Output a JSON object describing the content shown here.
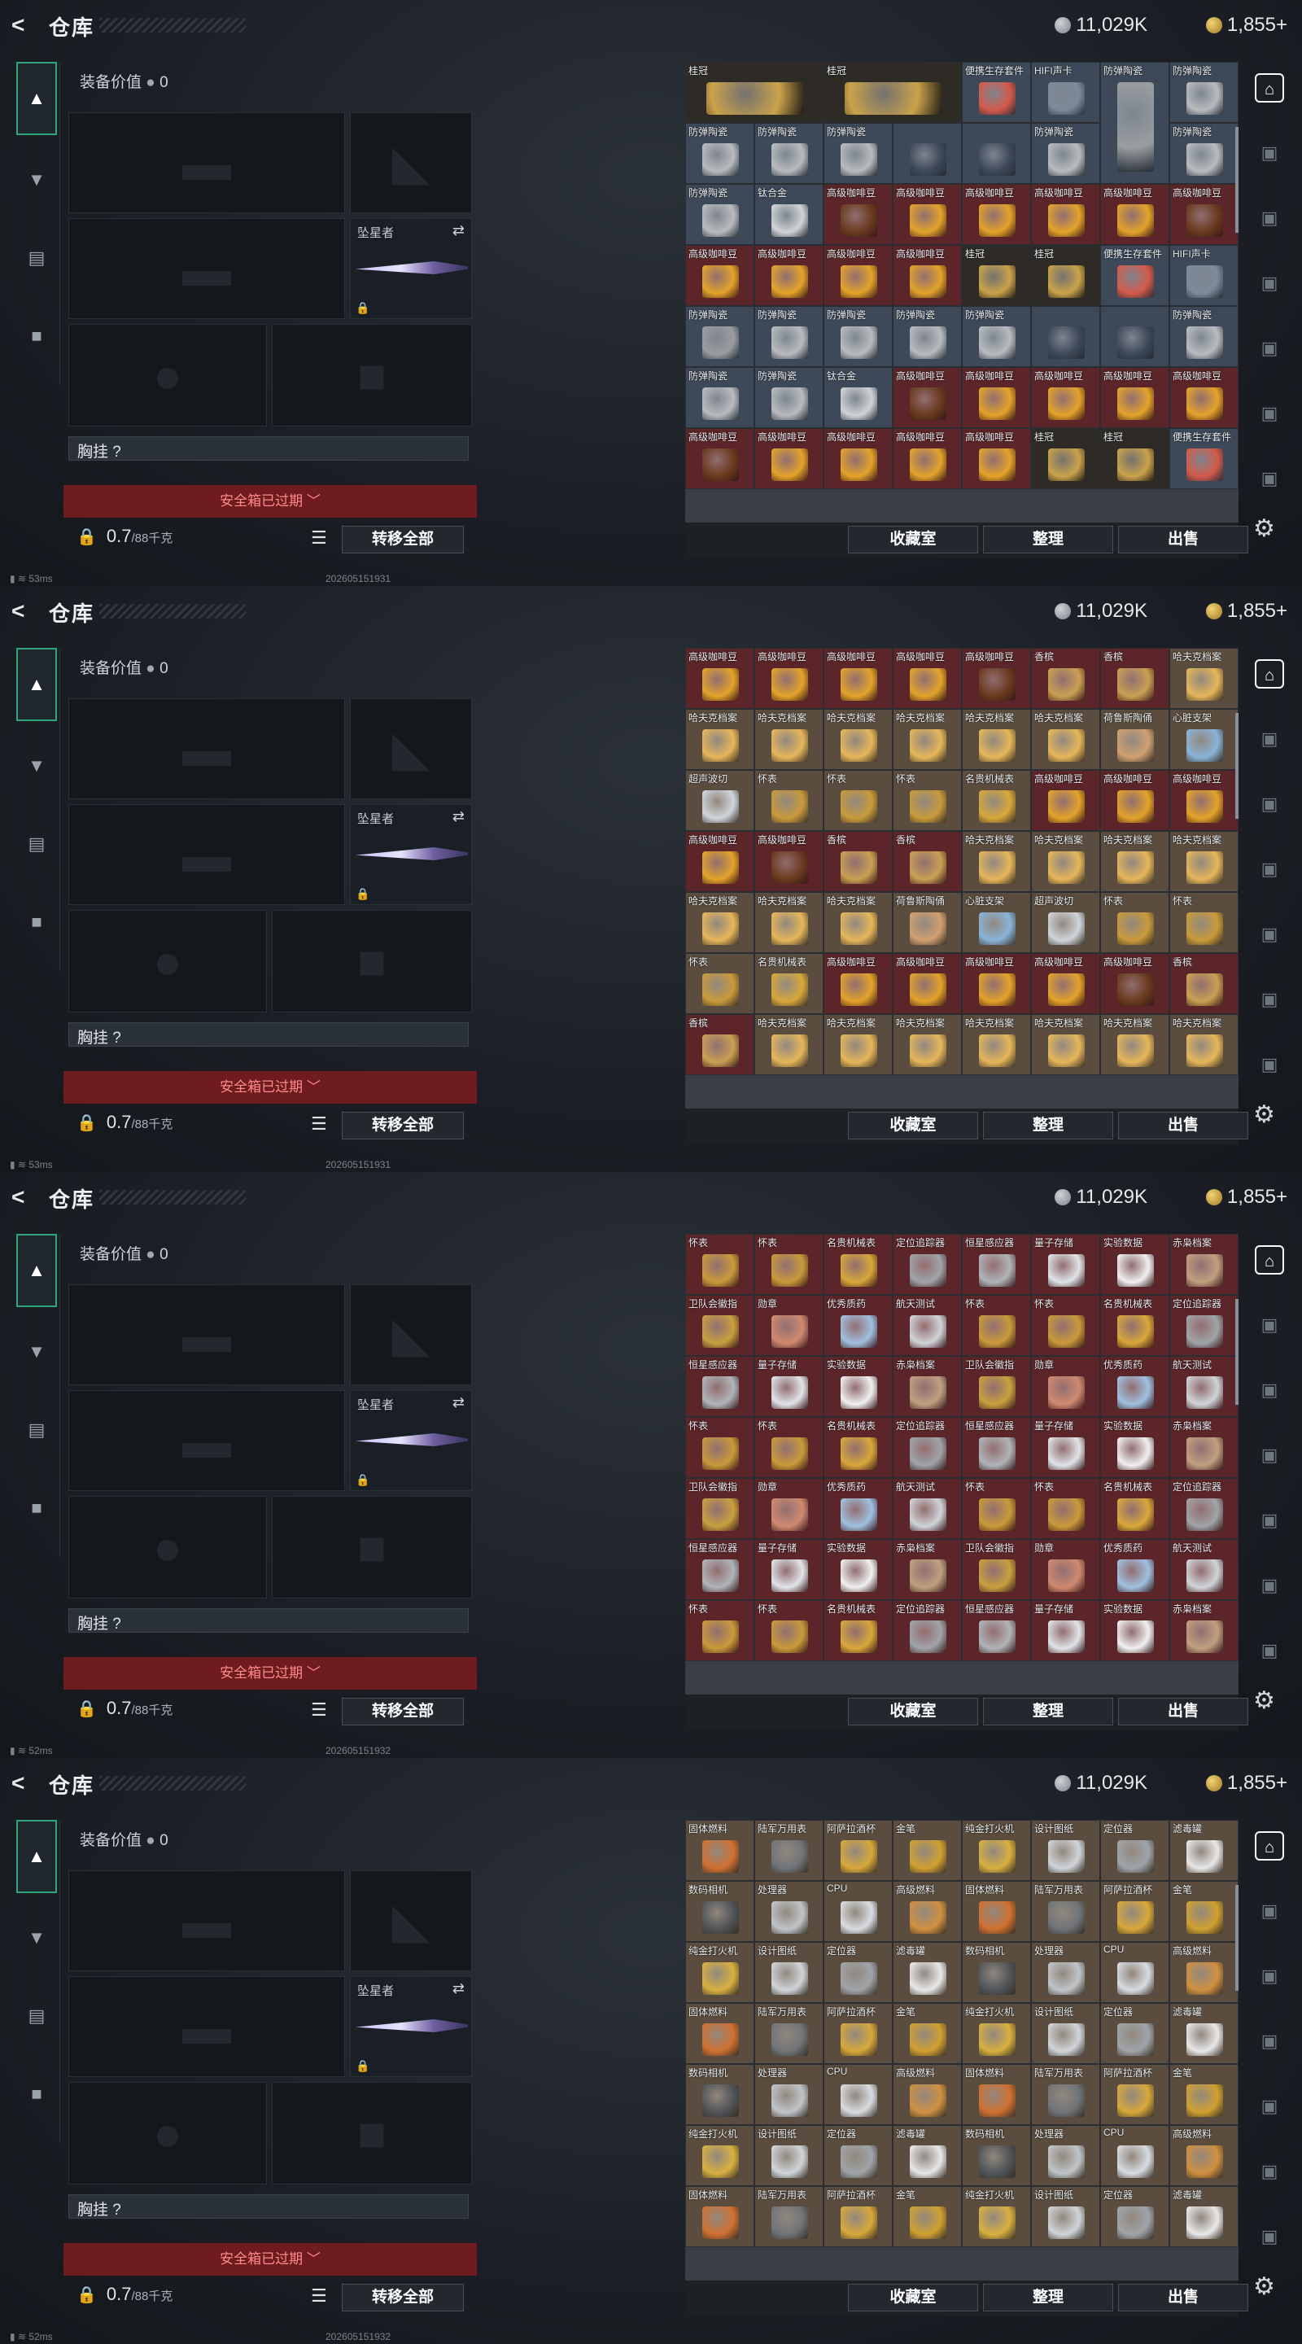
{
  "header": {
    "title": "仓库",
    "silver": "11,029K",
    "gold": "1,855+"
  },
  "loadout": {
    "equip_value_label": "装备价值",
    "equip_value": "0",
    "melee_name": "坠星者",
    "chest_label": "胸挂 ?",
    "safebox_text": "安全箱已过期",
    "weight": "0.7",
    "weight_cap": "/88千克",
    "transfer_all": "转移全部"
  },
  "footer": {
    "vault": "收藏室",
    "sort": "整理",
    "sell": "出售"
  },
  "status": {
    "ping_1": "53ms",
    "ping_2": "52ms",
    "time_1": "202605151931",
    "time_2": "202605151932"
  },
  "colors": {
    "accent": "#2fa57a",
    "danger": "#6e1c20",
    "red_bg": "#5b2529",
    "tan_bg": "#5a4c3e"
  },
  "screens": [
    {
      "ping": "53ms",
      "time": "202605151931",
      "cells": [
        {
          "name": "桂冠",
          "span": 2,
          "color": "#caa24a",
          "bg": "#2e2a26"
        },
        {
          "name": "桂冠",
          "span": 2,
          "color": "#caa24a",
          "bg": "#2e2a26"
        },
        {
          "name": "便携生存套件",
          "color": "#d45a4a",
          "bg": "#3d4858"
        },
        {
          "name": "HIFI声卡",
          "color": "#7a8a9a",
          "bg": "#3d4858"
        },
        {
          "name": "防弹陶瓷",
          "color": "#9a9ea2",
          "bg": "#3d4858",
          "tall": true
        },
        {
          "name": "防弹陶瓷",
          "color": "#b8bcbf",
          "bg": "#3d4858"
        },
        {
          "name": "防弹陶瓷",
          "color": "#b8bcbf",
          "bg": "#3d4858"
        },
        {
          "name": "防弹陶瓷",
          "color": "#b8bcbf",
          "bg": "#3d4858"
        },
        {
          "name": "防弹陶瓷",
          "color": "#b8bcbf",
          "bg": "#3d4858"
        },
        {
          "name": "",
          "color": "#3d4858",
          "bg": "#3d4858"
        },
        {
          "name": "",
          "color": "#3d4858",
          "bg": "#3d4858"
        },
        {
          "name": "防弹陶瓷",
          "color": "#b8bcbf",
          "bg": "#3d4858"
        },
        {
          "name": "防弹陶瓷",
          "color": "#b8bcbf",
          "bg": "#3d4858"
        },
        {
          "name": "防弹陶瓷",
          "color": "#b8bcbf",
          "bg": "#3d4858"
        },
        {
          "name": "钛合金",
          "color": "#d0d4d6",
          "bg": "#3d4858"
        },
        {
          "name": "高级咖啡豆",
          "color": "#6a3a1e",
          "bg": "#5b2529"
        },
        {
          "name": "高级咖啡豆",
          "color": "#e3a32a",
          "bg": "#5b2529"
        },
        {
          "name": "高级咖啡豆",
          "color": "#e3a32a",
          "bg": "#5b2529"
        },
        {
          "name": "高级咖啡豆",
          "color": "#e3a32a",
          "bg": "#5b2529"
        },
        {
          "name": "高级咖啡豆",
          "color": "#e3a32a",
          "bg": "#5b2529"
        },
        {
          "name": "高级咖啡豆",
          "color": "#6a3a1e",
          "bg": "#5b2529"
        },
        {
          "name": "高级咖啡豆",
          "color": "#e3a32a",
          "bg": "#5b2529"
        },
        {
          "name": "高级咖啡豆",
          "color": "#e3a32a",
          "bg": "#5b2529"
        },
        {
          "name": "高级咖啡豆",
          "color": "#e3a32a",
          "bg": "#5b2529"
        },
        {
          "name": "高级咖啡豆",
          "color": "#e3a32a",
          "bg": "#5b2529"
        }
      ]
    },
    {
      "ping": "53ms",
      "time": "202605151931",
      "cells": [
        {
          "name": "高级咖啡豆",
          "color": "#e3a32a",
          "bg": "#5b2529"
        },
        {
          "name": "高级咖啡豆",
          "color": "#e3a32a",
          "bg": "#5b2529"
        },
        {
          "name": "高级咖啡豆",
          "color": "#e3a32a",
          "bg": "#5b2529"
        },
        {
          "name": "高级咖啡豆",
          "color": "#e3a32a",
          "bg": "#5b2529"
        },
        {
          "name": "高级咖啡豆",
          "color": "#6a3a1e",
          "bg": "#5b2529"
        },
        {
          "name": "香槟",
          "color": "#c9a052",
          "bg": "#5b2529"
        },
        {
          "name": "香槟",
          "color": "#c9a052",
          "bg": "#5b2529"
        },
        {
          "name": "哈夫克档案",
          "color": "#e6b65a",
          "bg": "#5a4c3e"
        },
        {
          "name": "哈夫克档案",
          "color": "#e6b65a",
          "bg": "#5a4c3e"
        },
        {
          "name": "哈夫克档案",
          "color": "#e6b65a",
          "bg": "#5a4c3e"
        },
        {
          "name": "哈夫克档案",
          "color": "#e6b65a",
          "bg": "#5a4c3e"
        },
        {
          "name": "哈夫克档案",
          "color": "#e6b65a",
          "bg": "#5a4c3e"
        },
        {
          "name": "哈夫克档案",
          "color": "#e6b65a",
          "bg": "#5a4c3e"
        },
        {
          "name": "哈夫克档案",
          "color": "#e6b65a",
          "bg": "#5a4c3e"
        },
        {
          "name": "荷鲁斯陶俑",
          "color": "#d0a070",
          "bg": "#5a4c3e"
        },
        {
          "name": "心脏支架",
          "color": "#8ab4d8",
          "bg": "#5a4c3e"
        },
        {
          "name": "超声波切",
          "color": "#cfd5db",
          "bg": "#5a4c3e"
        },
        {
          "name": "怀表",
          "color": "#c99a3a",
          "bg": "#5a4c3e"
        },
        {
          "name": "怀表",
          "color": "#c99a3a",
          "bg": "#5a4c3e"
        },
        {
          "name": "怀表",
          "color": "#c99a3a",
          "bg": "#5a4c3e"
        },
        {
          "name": "名贵机械表",
          "color": "#d8a83a",
          "bg": "#5a4c3e"
        }
      ]
    },
    {
      "ping": "52ms",
      "time": "202605151932",
      "cells": [
        {
          "name": "怀表",
          "color": "#c99a3a",
          "bg": "#5b2529"
        },
        {
          "name": "怀表",
          "color": "#c99a3a",
          "bg": "#5b2529"
        },
        {
          "name": "名贵机械表",
          "color": "#d8a83a",
          "bg": "#5b2529"
        },
        {
          "name": "定位追踪器",
          "color": "#a0a4a8",
          "bg": "#5b2529"
        },
        {
          "name": "恒星感应器",
          "color": "#b0b4b8",
          "bg": "#5b2529"
        },
        {
          "name": "量子存储",
          "color": "#e0e4e8",
          "bg": "#5b2529"
        },
        {
          "name": "实验数据",
          "color": "#f0f0f0",
          "bg": "#5b2529"
        },
        {
          "name": "赤枭档案",
          "color": "#c0a080",
          "bg": "#5b2529"
        },
        {
          "name": "卫队会徽指",
          "color": "#c8a040",
          "bg": "#5b2529"
        },
        {
          "name": "勋章",
          "color": "#d08a70",
          "bg": "#5b2529"
        },
        {
          "name": "优秀质药",
          "color": "#a0c0e0",
          "bg": "#5b2529"
        },
        {
          "name": "航天测试",
          "color": "#d0d4d8",
          "bg": "#5b2529"
        }
      ]
    },
    {
      "ping": "52ms",
      "time": "202605151932",
      "cells": [
        {
          "name": "固体燃料",
          "color": "#d07030",
          "bg": "#5a4c3e"
        },
        {
          "name": "陆军万用表",
          "color": "#707478",
          "bg": "#5a4c3e"
        },
        {
          "name": "阿萨拉酒杯",
          "color": "#d8a83a",
          "bg": "#5a4c3e"
        },
        {
          "name": "金笔",
          "color": "#d0a030",
          "bg": "#5a4c3e"
        },
        {
          "name": "纯金打火机",
          "color": "#d8b040",
          "bg": "#5a4c3e"
        },
        {
          "name": "设计图纸",
          "color": "#d0d4d8",
          "bg": "#5a4c3e"
        },
        {
          "name": "定位器",
          "color": "#a0a4a8",
          "bg": "#5a4c3e"
        },
        {
          "name": "滤毒罐",
          "color": "#e8e8e8",
          "bg": "#5a4c3e"
        },
        {
          "name": "数码相机",
          "color": "#505458",
          "bg": "#5a4c3e"
        },
        {
          "name": "处理器",
          "color": "#c0c4c8",
          "bg": "#5a4c3e"
        },
        {
          "name": "CPU",
          "color": "#d8dce0",
          "bg": "#5a4c3e"
        },
        {
          "name": "高级燃料",
          "color": "#d09040",
          "bg": "#5a4c3e"
        }
      ]
    }
  ]
}
